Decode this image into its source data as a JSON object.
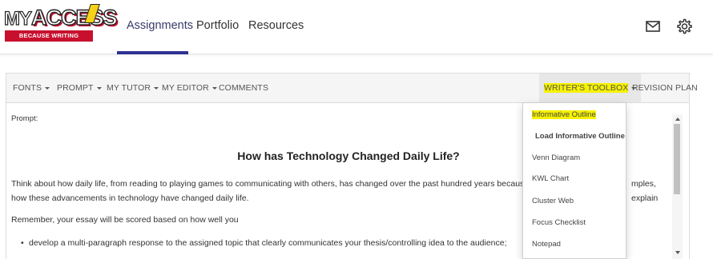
{
  "header": {
    "logo": {
      "word_my": "MY",
      "word_access": "ACCESS",
      "tagline": "BECAUSE WRITING MATTERS"
    },
    "nav": [
      {
        "label": "Assignments",
        "active": true
      },
      {
        "label": "Portfolio",
        "active": false
      },
      {
        "label": "Resources",
        "active": false
      }
    ],
    "icons": [
      "mail-icon",
      "gear-icon"
    ]
  },
  "toolbar": {
    "fonts": "FONTS",
    "prompt": "PROMPT",
    "my_tutor": "MY TUTOR",
    "my_editor": "MY EDITOR",
    "comments": "COMMENTS",
    "writers_toolbox": "WRITER'S TOOLBOX",
    "revision_plan": "REVISION PLAN"
  },
  "document": {
    "prompt_label": "Prompt:",
    "title": "How has Technology Changed Daily Life?",
    "para1_line1": "Think about how daily life, from reading to playing games to communicating with others, has changed over the past hundred years because of technology.",
    "para1_tail": "mples, explain",
    "para1_line2": "how these advancements in technology have changed daily life.",
    "para2": "Remember, your essay will be scored based on how well you",
    "bullet1": "develop a multi-paragraph response to the assigned topic that clearly communicates your thesis/controlling idea to the audience;"
  },
  "writers_toolbox_menu": {
    "items": [
      {
        "label": "Informative Outline",
        "highlighted": true
      },
      {
        "label": "Load Informative Outline",
        "bold": true
      },
      {
        "label": "Venn Diagram"
      },
      {
        "label": "KWL Chart"
      },
      {
        "label": "Cluster Web"
      },
      {
        "label": "Focus Checklist"
      },
      {
        "label": "Notepad"
      }
    ]
  },
  "colors": {
    "brand_red": "#c8102e",
    "brand_yellow": "#f7d117",
    "nav_underline": "#2e3192",
    "highlight": "#f6f200"
  }
}
